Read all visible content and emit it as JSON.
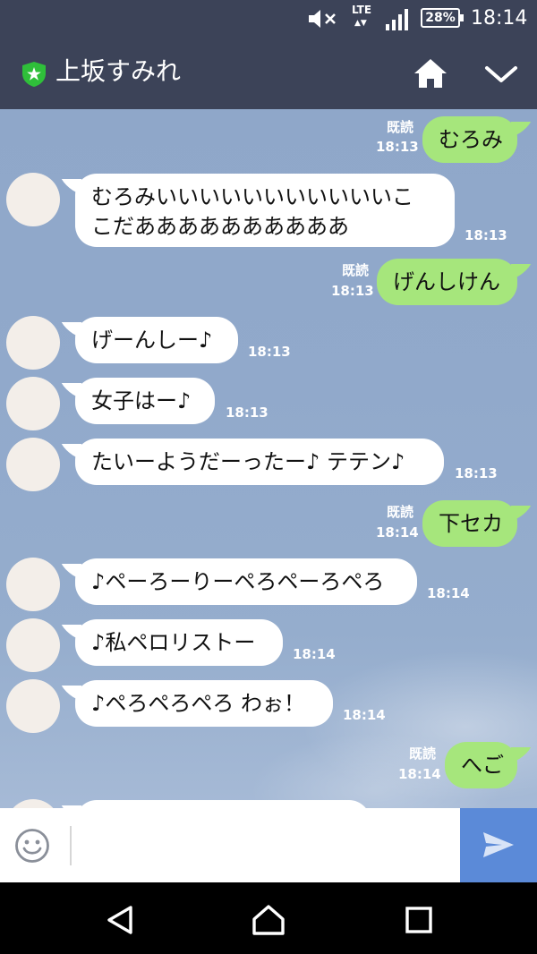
{
  "status_bar": {
    "network": "LTE",
    "battery": "28%",
    "time": "18:14"
  },
  "header": {
    "chat_title": "上坂すみれ"
  },
  "messages": [
    {
      "side": "out",
      "text": "むろみ",
      "read": "既読",
      "time": "18:13"
    },
    {
      "side": "in",
      "lines": [
        "むろみいいいいいいいいいいいこ",
        "こだああああああああああ"
      ],
      "time": "18:13"
    },
    {
      "side": "out",
      "text": "げんしけん",
      "read": "既読",
      "time": "18:13"
    },
    {
      "side": "in",
      "text": "げーんしー♪",
      "time": "18:13"
    },
    {
      "side": "in",
      "text": "女子はー♪",
      "time": "18:13"
    },
    {
      "side": "in",
      "text": "たいーようだーったー♪ テテン♪",
      "time": "18:13"
    },
    {
      "side": "out",
      "text": "下セカ",
      "read": "既読",
      "time": "18:14"
    },
    {
      "side": "in",
      "text": "♪ペーろーりーペろペーろペろ",
      "time": "18:14"
    },
    {
      "side": "in",
      "text": "♪私ペロリストー",
      "time": "18:14"
    },
    {
      "side": "in",
      "text": "♪ペろペろペろ わぉ！",
      "time": "18:14"
    },
    {
      "side": "out",
      "text": "へご",
      "read": "既読",
      "time": "18:14"
    }
  ],
  "input": {
    "placeholder": ""
  },
  "icons": {
    "mute": "mute-icon",
    "signal": "signal-icon",
    "battery": "battery-icon",
    "shield": "shield-star-icon",
    "home": "home-icon",
    "chevron": "chevron-down-icon",
    "emoji": "emoji-icon",
    "send": "send-icon",
    "back": "back-triangle-icon",
    "home_nav": "home-nav-icon",
    "recents": "recents-square-icon"
  },
  "colors": {
    "header_bg": "#3c4358",
    "outgoing_bubble": "#a6e67c",
    "incoming_bubble": "#ffffff",
    "send_button": "#5b8ad8",
    "shield_green": "#2fbf3a"
  }
}
